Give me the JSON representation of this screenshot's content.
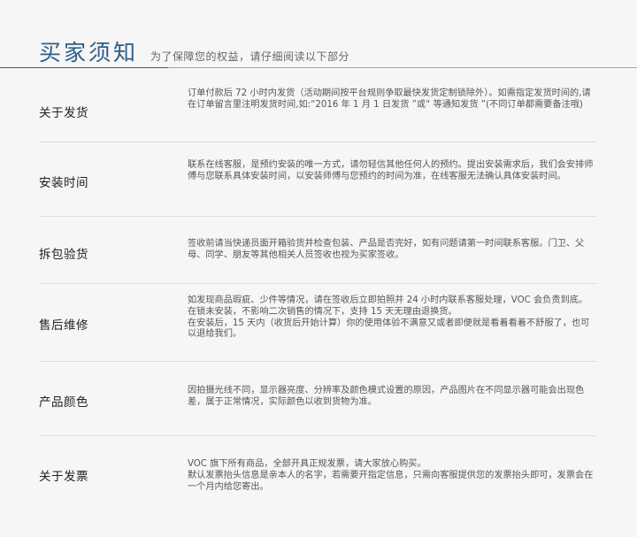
{
  "header": {
    "title": "买家须知",
    "subtitle": "为了保障您的权益，请仔细阅读以下部分"
  },
  "sections": [
    {
      "title": "关于发货",
      "lines": [
        "订单付款后 72 小时内发货（活动期间按平台规则争取最快发货定制锁除外）。如需指定发货时间的,请在订单留言里注明发货时间,如:“2016 年 1 月 1 日发货 ”或“ 等通知发货 ”(不同订单都需要备注哦)"
      ]
    },
    {
      "title": "安装时间",
      "lines": [
        "联系在线客服，是预约安装的唯一方式，请勿轻信其他任何人的预约。提出安装需求后，我们会安排师傅与您联系具体安装时间，以安装师傅与您预约的时间为准，在线客服无法确认具体安装时间。"
      ]
    },
    {
      "title": "拆包验货",
      "lines": [
        "签收前请当快递员面开箱验货并检查包装、产品是否完好，如有问题请第一时间联系客服。门卫、父母、同学、朋友等其他相关人员签收也视为买家签收。"
      ]
    },
    {
      "title": "售后维修",
      "lines": [
        "如发现商品瑕疵、少件等情况，请在签收后立即拍照并 24 小时内联系客服处理，VOC 会负责到底。",
        "在锁未安装，不影响二次销售的情况下，支持 15 天无理由退换货。",
        "在安装后，15 天内（收货后开始计算）你的使用体验不满意又或者即便就是看着看着不舒服了，也可以退给我们。"
      ]
    },
    {
      "title": "产品颜色",
      "lines": [
        "因拍摄光线不同，显示器亮度、分辨率及颜色模式设置的原因，产品图片在不同显示器可能会出现色差，属于正常情况，实际颜色以收到货物为准。"
      ]
    },
    {
      "title": "关于发票",
      "lines": [
        "VOC 旗下所有商品，全部开具正规发票，请大家放心购买。",
        "默认发票抬头信息是亲本人的名字，若需要开指定信息，只需向客服提供您的发票抬头即可，发票会在一个月内给您寄出。"
      ]
    }
  ]
}
